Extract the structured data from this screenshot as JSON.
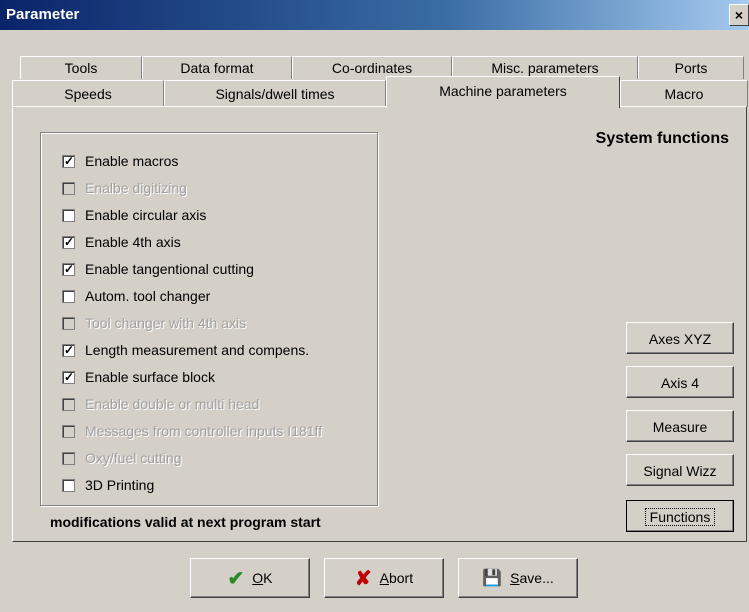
{
  "window": {
    "title": "Parameter",
    "close_label": "×"
  },
  "tabs_row1": [
    "Tools",
    "Data format",
    "Co-ordinates",
    "Misc. parameters",
    "Ports"
  ],
  "tabs_row2": [
    "Speeds",
    "Signals/dwell times",
    "Machine parameters",
    "Macro"
  ],
  "active_tab": "Machine parameters",
  "panel": {
    "heading": "System functions",
    "note": "modifications valid at next program start"
  },
  "options": [
    {
      "label": "Enable macros",
      "checked": true,
      "enabled": true
    },
    {
      "label": "Enalbe digitizing",
      "checked": false,
      "enabled": false
    },
    {
      "label": "Enable circular axis",
      "checked": false,
      "enabled": true
    },
    {
      "label": "Enable 4th axis",
      "checked": true,
      "enabled": true
    },
    {
      "label": "Enable tangentional cutting",
      "checked": true,
      "enabled": true
    },
    {
      "label": "Autom. tool changer",
      "checked": false,
      "enabled": true
    },
    {
      "label": "Tool changer with 4th axis",
      "checked": false,
      "enabled": false
    },
    {
      "label": "Length measurement and compens.",
      "checked": true,
      "enabled": true
    },
    {
      "label": "Enable surface block",
      "checked": true,
      "enabled": true
    },
    {
      "label": "Enable double or multi head",
      "checked": false,
      "enabled": false
    },
    {
      "label": "Messages from controller inputs I181ff",
      "checked": false,
      "enabled": false
    },
    {
      "label": "Oxy/fuel cutting",
      "checked": false,
      "enabled": false
    },
    {
      "label": "3D Printing",
      "checked": false,
      "enabled": true
    }
  ],
  "side_buttons": [
    "Axes XYZ",
    "Axis 4",
    "Measure",
    "Signal Wizz",
    "Functions"
  ],
  "bottom_buttons": {
    "ok": {
      "underlined": "O",
      "rest": "K",
      "icon": "✔"
    },
    "abort": {
      "underlined": "A",
      "rest": "bort",
      "icon": "✘"
    },
    "save": {
      "underlined": "S",
      "rest": "ave...",
      "icon": "💾"
    }
  },
  "colors": {
    "face": "#d4d0c8",
    "title_start": "#0a246a",
    "title_end": "#a6caf0",
    "ok_icon": "#2a8a2a",
    "abort_icon": "#c00000"
  }
}
